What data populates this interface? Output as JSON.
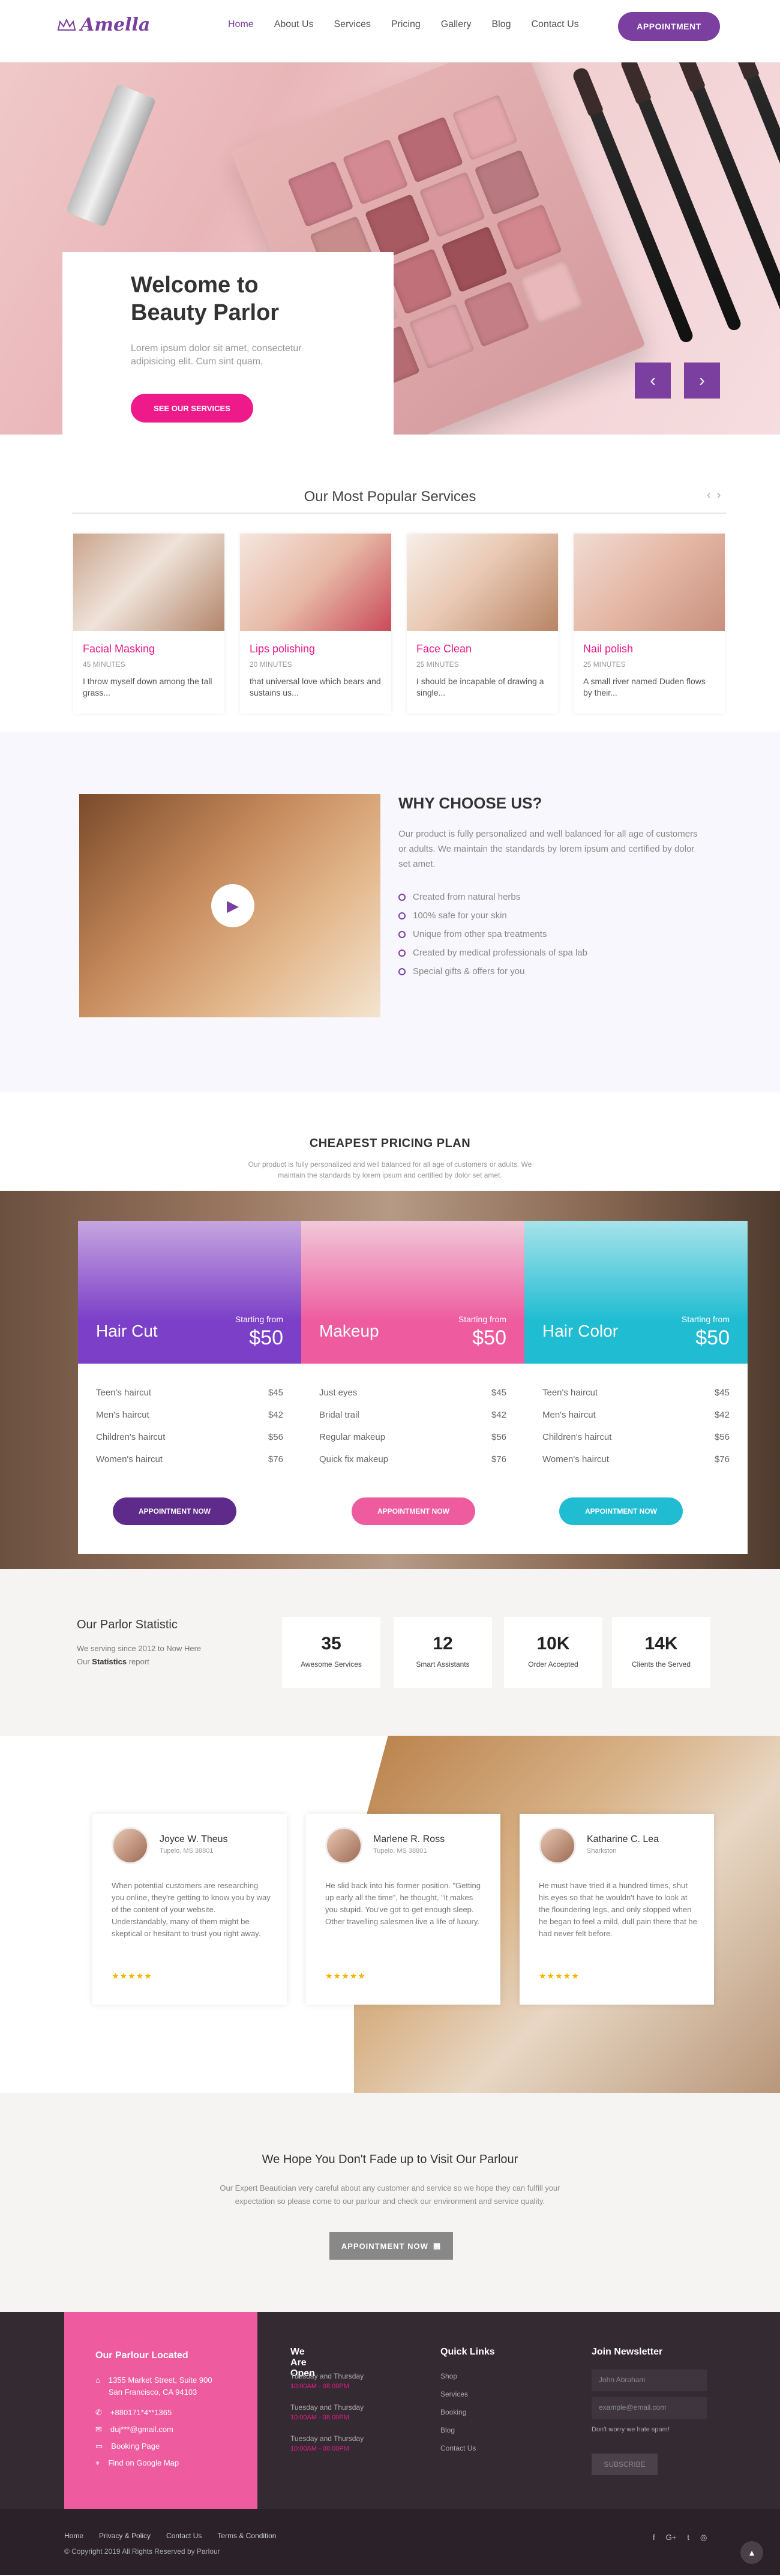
{
  "brand": {
    "name": "Amella",
    "accent": "#7b3fa0",
    "pink": "#e91a8a"
  },
  "nav": {
    "items": [
      "Home",
      "About Us",
      "Services",
      "Pricing",
      "Gallery",
      "Blog",
      "Contact Us"
    ],
    "appointment": "APPOINTMENT"
  },
  "hero": {
    "title_line1": "Welcome to",
    "title_line2": "Beauty Parlor",
    "subtitle": "Lorem ipsum dolor sit amet, consectetur adipisicing elit. Cum sint quam,",
    "button": "SEE OUR SERVICES",
    "prev_icon": "chevron-left-icon",
    "next_icon": "chevron-right-icon"
  },
  "services": {
    "title": "Our Most Popular Services",
    "items": [
      {
        "name": "Facial Masking",
        "duration": "45 MINUTES",
        "desc": "I throw myself down among the tall grass..."
      },
      {
        "name": "Lips polishing",
        "duration": "20 MINUTES",
        "desc": "that universal love which bears and sustains us..."
      },
      {
        "name": "Face Clean",
        "duration": "25 MINUTES",
        "desc": "I should be incapable of drawing a single..."
      },
      {
        "name": "Nail polish",
        "duration": "25 MINUTES",
        "desc": "A small river named Duden flows by their..."
      }
    ]
  },
  "why": {
    "title": "WHY CHOOSE US?",
    "text": "Our product is fully personalized and well balanced for all age of customers or adults. We maintain the standards by lorem ipsum and certified by dolor set amet.",
    "points": [
      "Created from natural herbs",
      "100% safe for your skin",
      "Unique from other spa treatments",
      "Created by medical professionals of spa lab",
      "Special gifts & offers for you"
    ]
  },
  "pricing": {
    "title": "CHEAPEST PRICING PLAN",
    "subtitle_line1": "Our product is fully personalized and well balanced for all age of customers or adults. We",
    "subtitle_line2": "maintain the standards by lorem ipsum and certified by dolor set amet.",
    "plans": [
      {
        "name": "Hair Cut",
        "from": "Starting from",
        "price": "$50",
        "color": "#7b3fc8",
        "button": "APPOINTMENT NOW",
        "rows": [
          [
            "Teen's haircut",
            "$45"
          ],
          [
            "Men's haircut",
            "$42"
          ],
          [
            "Children's haircut",
            "$56"
          ],
          [
            "Women's haircut",
            "$76"
          ]
        ]
      },
      {
        "name": "Makeup",
        "from": "Starting from",
        "price": "$50",
        "color": "#ee5c9f",
        "button": "APPOINTMENT NOW",
        "rows": [
          [
            "Just eyes",
            "$45"
          ],
          [
            "Bridal trail",
            "$42"
          ],
          [
            "Regular makeup",
            "$56"
          ],
          [
            "Quick fix makeup",
            "$76"
          ]
        ]
      },
      {
        "name": "Hair Color",
        "from": "Starting from",
        "price": "$50",
        "color": "#20bcd2",
        "button": "APPOINTMENT NOW",
        "rows": [
          [
            "Teen's haircut",
            "$45"
          ],
          [
            "Men's haircut",
            "$42"
          ],
          [
            "Children's haircut",
            "$56"
          ],
          [
            "Women's haircut",
            "$76"
          ]
        ]
      }
    ]
  },
  "stats": {
    "title": "Our Parlor Statistic",
    "text_line1": "We serving since 2012 to Now Here",
    "text_line2_prefix": "Our ",
    "text_line2_bold": "Statistics",
    "text_line2_suffix": " report",
    "items": [
      {
        "num": "35",
        "label": "Awesome Services"
      },
      {
        "num": "12",
        "label": "Smart Assistants"
      },
      {
        "num": "10K",
        "label": "Order Accepted"
      },
      {
        "num": "14K",
        "label": "Clients the Served"
      }
    ]
  },
  "testimonials": [
    {
      "name": "Joyce W. Theus",
      "loc": "Tupelo, MS 38801",
      "text": "When potential customers are researching you online, they're getting to know you by way of the content of your website. Understandably, many of them might be skeptical or hesitant to trust you right away.",
      "stars": "★★★★★"
    },
    {
      "name": "Marlene R. Ross",
      "loc": "Tupelo, MS 38801",
      "text": "He slid back into his former position. \"Getting up early all the time\", he thought, \"it makes you stupid. You've got to get enough sleep. Other travelling salesmen live a life of luxury.",
      "stars": "★★★★★"
    },
    {
      "name": "Katharine C. Lea",
      "loc": "Sharkston",
      "text": "He must have tried it a hundred times, shut his eyes so that he wouldn't have to look at the floundering legs, and only stopped when he began to feel a mild, dull pain there that he had never felt before.",
      "stars": "★★★★★"
    }
  ],
  "visit": {
    "title": "We Hope You Don't Fade up to Visit Our Parlour",
    "text_line1": "Our Expert Beautician very careful about any customer and service so we hope they can fulfill your",
    "text_line2": "expectation so please come to our parlour and check our environment and service quality.",
    "button": "APPOINTMENT NOW"
  },
  "footer": {
    "located": {
      "title": "Our Parlour Located",
      "address_line1": "1355 Market Street, Suite 900",
      "address_line2": "San Francisco, CA 94103",
      "phone": "+880171*4**1365",
      "email": "duj***@gmail.com",
      "booking": "Booking Page",
      "map": "Find on Google Map"
    },
    "open": {
      "title": "We Are Open",
      "slots": [
        {
          "day": "Tuesday and Thursday",
          "time": "10:00AM - 08:00PM"
        },
        {
          "day": "Tuesday and Thursday",
          "time": "10:00AM - 08:00PM"
        },
        {
          "day": "Tuesday and Thursday",
          "time": "10:00AM - 08:00PM"
        }
      ]
    },
    "quick": {
      "title": "Quick Links",
      "links": [
        "Shop",
        "Services",
        "Booking",
        "Blog",
        "Contact Us"
      ]
    },
    "newsletter": {
      "title": "Join Newsletter",
      "name_placeholder": "John Abraham",
      "email_placeholder": "example@email.com",
      "note": "Don't worry we hate spam!",
      "button": "SUBSCRIBE"
    },
    "bottom_links": [
      "Home",
      "Privacy & Policy",
      "Contact Us",
      "Terms & Condition"
    ],
    "copyright": "© Copyright 2019 All Rights Reserved by Parlour",
    "socials": [
      "f",
      "G+",
      "t",
      "◎"
    ]
  }
}
